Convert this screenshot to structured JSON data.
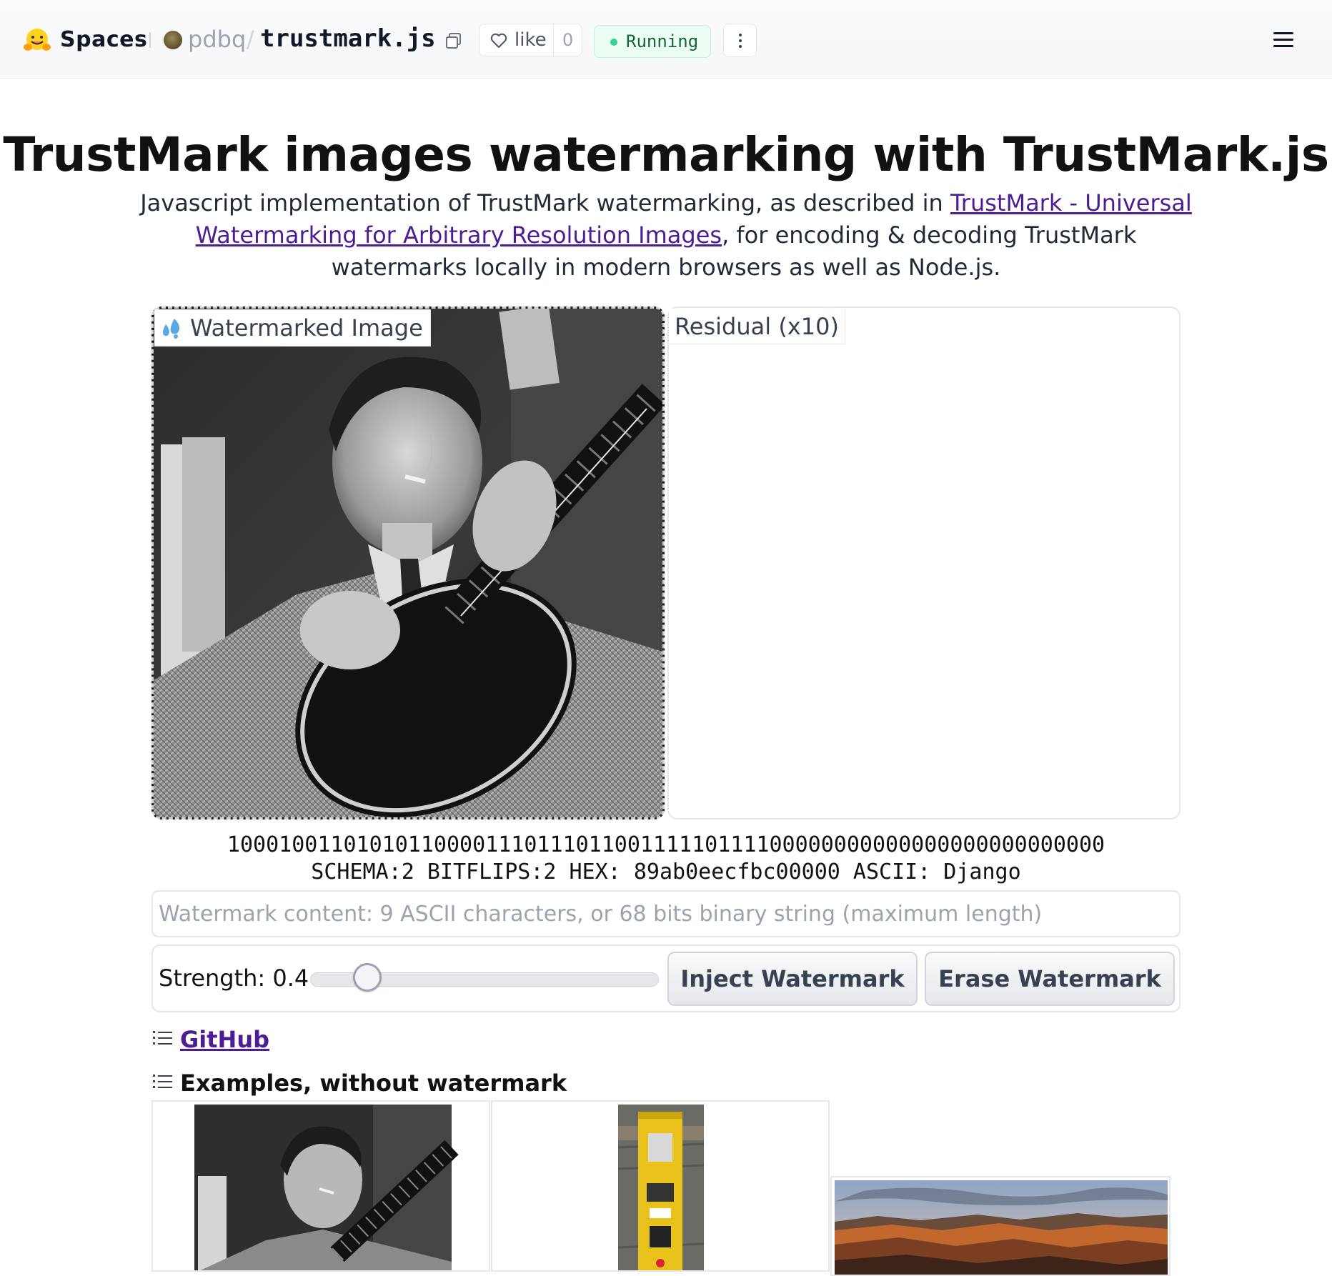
{
  "header": {
    "brand_label": "Spaces",
    "owner": "pdbq",
    "separator": "/",
    "repo": "trustmark.js",
    "like_label": "like",
    "like_count": "0",
    "status": "Running",
    "icons": [
      "hugging-face-logo",
      "copy-icon",
      "heart-icon",
      "kebab-menu-icon",
      "hamburger-menu-icon"
    ]
  },
  "main": {
    "title": "TrustMark images watermarking with TrustMark.js",
    "intro_prefix": "Javascript implementation of TrustMark watermarking, as described in ",
    "intro_link": "TrustMark - Universal Watermarking for Arbitrary Resolution Images",
    "intro_suffix": ", for encoding & decoding TrustMark watermarks locally in modern browsers as well as Node.js.",
    "watermarked_label": "Watermarked Image",
    "residual_label": "Residual (x10)",
    "decoded_bits": "10001001101010110000111011101100111110111100000000000000000000000000",
    "decoded_info": "SCHEMA:2 BITFLIPS:2 HEX: 89ab0eecfbc00000 ASCII: Django",
    "watermark_input": {
      "value": "",
      "placeholder": "Watermark content: 9 ASCII characters, or 68 bits binary string (maximum length)"
    },
    "strength_label": "Strength: 0.4",
    "strength_value": 0.4,
    "inject_button": "Inject Watermark",
    "erase_button": "Erase Watermark",
    "github_link": "GitHub",
    "examples_heading": "Examples, without watermark"
  },
  "colors": {
    "link": "#4c1d95",
    "running_bg": "#ecfdf3",
    "running_dot": "#34d399",
    "running_text": "#166534"
  }
}
